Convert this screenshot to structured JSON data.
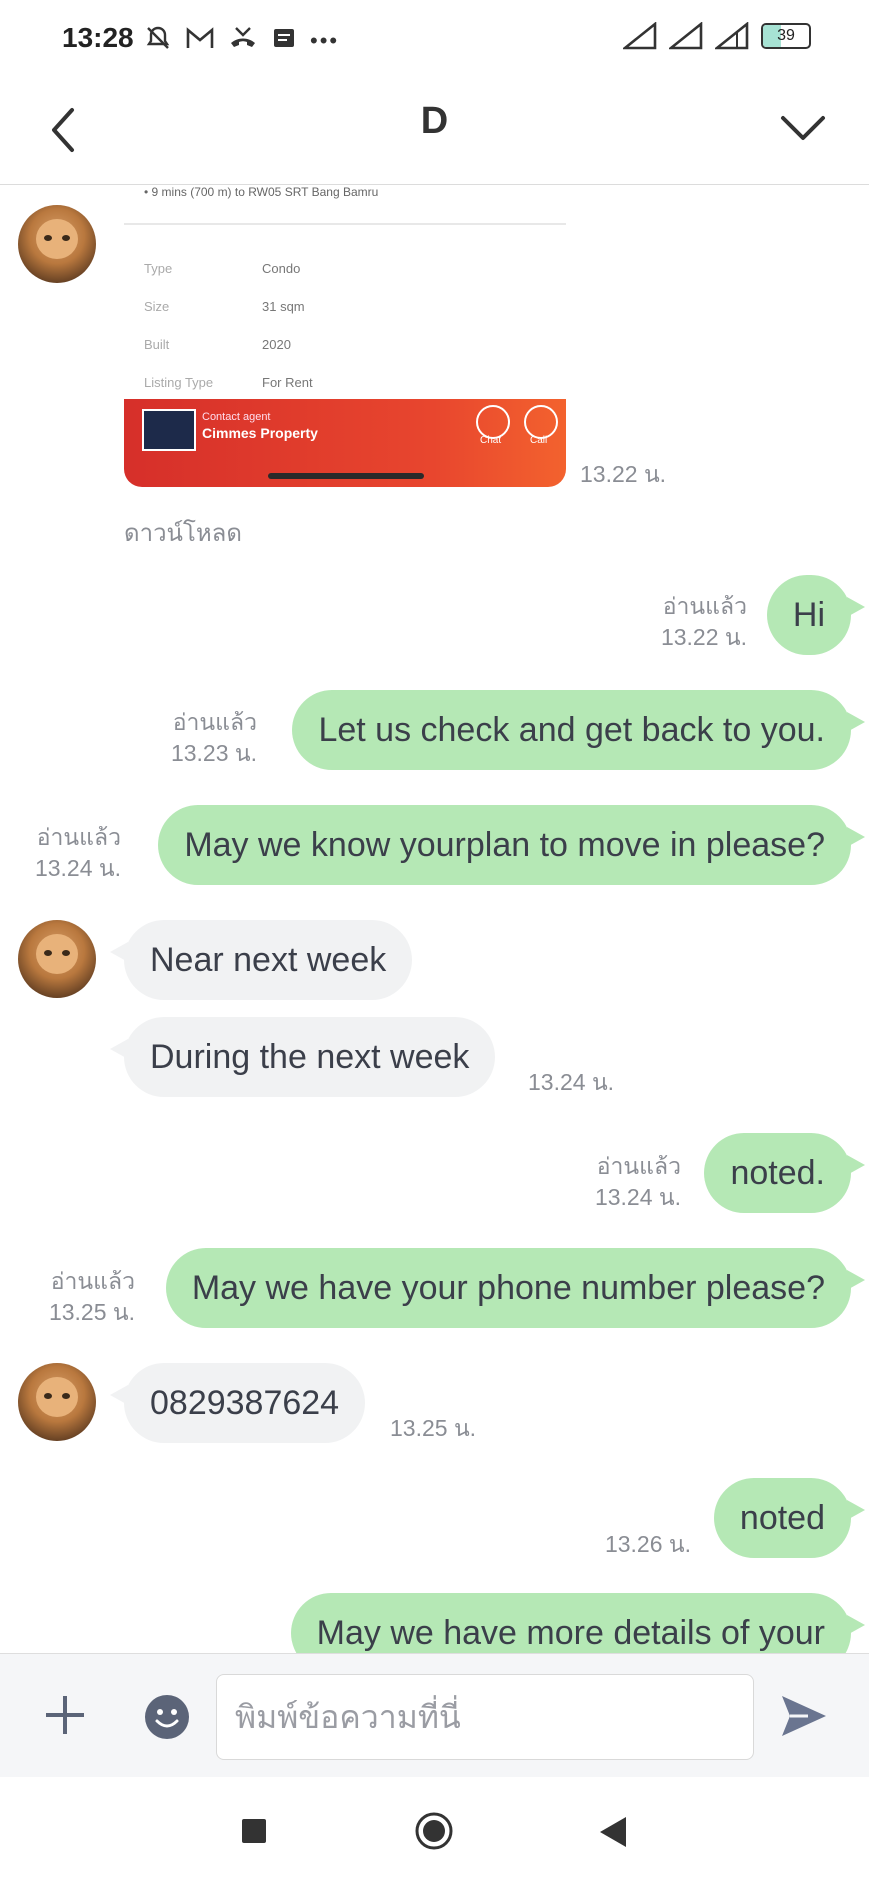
{
  "status_bar": {
    "time": "13:28",
    "icons": [
      "bell-muted-icon",
      "gmail-icon",
      "missed-call-icon",
      "message-icon",
      "more-dots-icon"
    ],
    "more": "•••",
    "battery": "39",
    "battery_level_percent": 39
  },
  "header": {
    "title": "D",
    "back_icon": "chevron-left-icon",
    "more_icon": "chevron-down-icon"
  },
  "colors": {
    "outgoing_bubble": "#b5e8b5",
    "incoming_bubble": "#f1f2f3",
    "meta_text": "#8a8d94"
  },
  "image_card": {
    "top_text": "• 9 mins (700 m) to RW05 SRT Bang Bamru",
    "rows": [
      {
        "key": "Type",
        "value": "Condo"
      },
      {
        "key": "Size",
        "value": "31 sqm"
      },
      {
        "key": "Built",
        "value": "2020"
      },
      {
        "key": "Listing Type",
        "value": "For Rent"
      }
    ],
    "agent_label": "Contact agent",
    "agent_name": "Cimmes Property",
    "btn1": "Chat",
    "btn2": "Call",
    "time": "13.22 น.",
    "download": "ดาวน์โหลด"
  },
  "messages": [
    {
      "dir": "out",
      "text": "Hi",
      "read": "อ่านแล้ว",
      "time": "13.22 น."
    },
    {
      "dir": "out",
      "text": "Let us check and get back to you.",
      "read": "อ่านแล้ว",
      "time": "13.23 น."
    },
    {
      "dir": "out",
      "text": "May we know yourplan to move in please?",
      "read": "อ่านแล้ว",
      "time": "13.24 น."
    },
    {
      "dir": "in",
      "text": "Near next week",
      "time": ""
    },
    {
      "dir": "in",
      "text": "During the next week",
      "time": "13.24 น."
    },
    {
      "dir": "out",
      "text": "noted.",
      "read": "อ่านแล้ว",
      "time": "13.24 น."
    },
    {
      "dir": "out",
      "text": "May we have your phone number please?",
      "read": "อ่านแล้ว",
      "time": "13.25 น."
    },
    {
      "dir": "in",
      "text": "0829387624",
      "time": "13.25 น."
    },
    {
      "dir": "out",
      "text": "noted",
      "read": "",
      "time": "13.26 น."
    },
    {
      "dir": "out",
      "text": "May we have more details of your",
      "read": "",
      "time": ""
    }
  ],
  "input": {
    "placeholder": "พิมพ์ข้อความที่นี่",
    "plus_icon": "plus-icon",
    "emoji_icon": "emoji-icon",
    "send_icon": "send-icon"
  },
  "nav": {
    "recents": "square-icon",
    "home": "circle-icon",
    "back": "triangle-back-icon"
  }
}
